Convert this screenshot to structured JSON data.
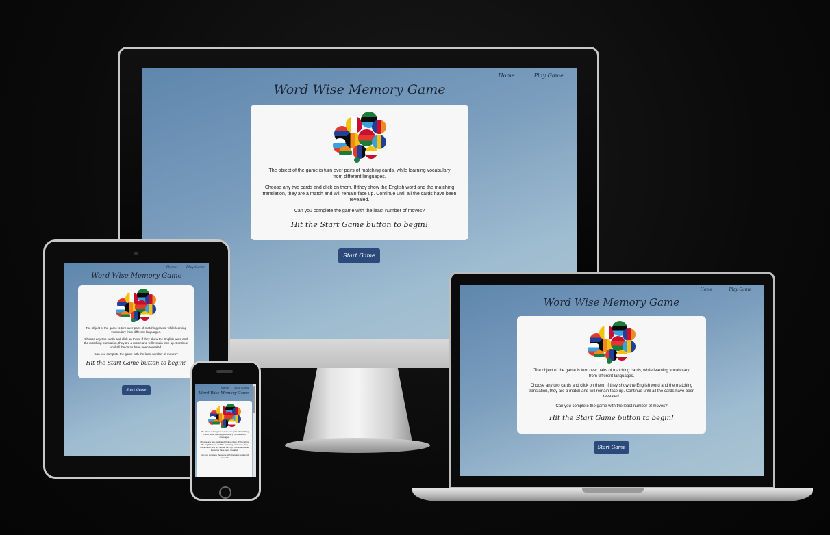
{
  "site": {
    "nav": {
      "home": "Home",
      "play": "Play Game"
    },
    "title": "Word Wise Memory Game",
    "intro": "The object of the game is turn over pairs of matching cards, while learning vocabulary from different languages.",
    "instructions": "Choose any two cards and click on them. If they show the English word and the matching translation, they are a match and will remain face up. Continue until all the cards have been revealed.",
    "question": "Can you complete the game with the least number of moves?",
    "cta": "Hit the Start Game button to begin!",
    "start_button": "Start Game"
  },
  "devices": [
    "desktop",
    "laptop",
    "tablet",
    "phone"
  ],
  "flag_colors": [
    "#e03a2f",
    "#f4c20d",
    "#1c7c3c",
    "#1f3f99",
    "#ffffff",
    "#0a0a0a",
    "#c8102e",
    "#3aa0e0",
    "#f08a1c"
  ]
}
